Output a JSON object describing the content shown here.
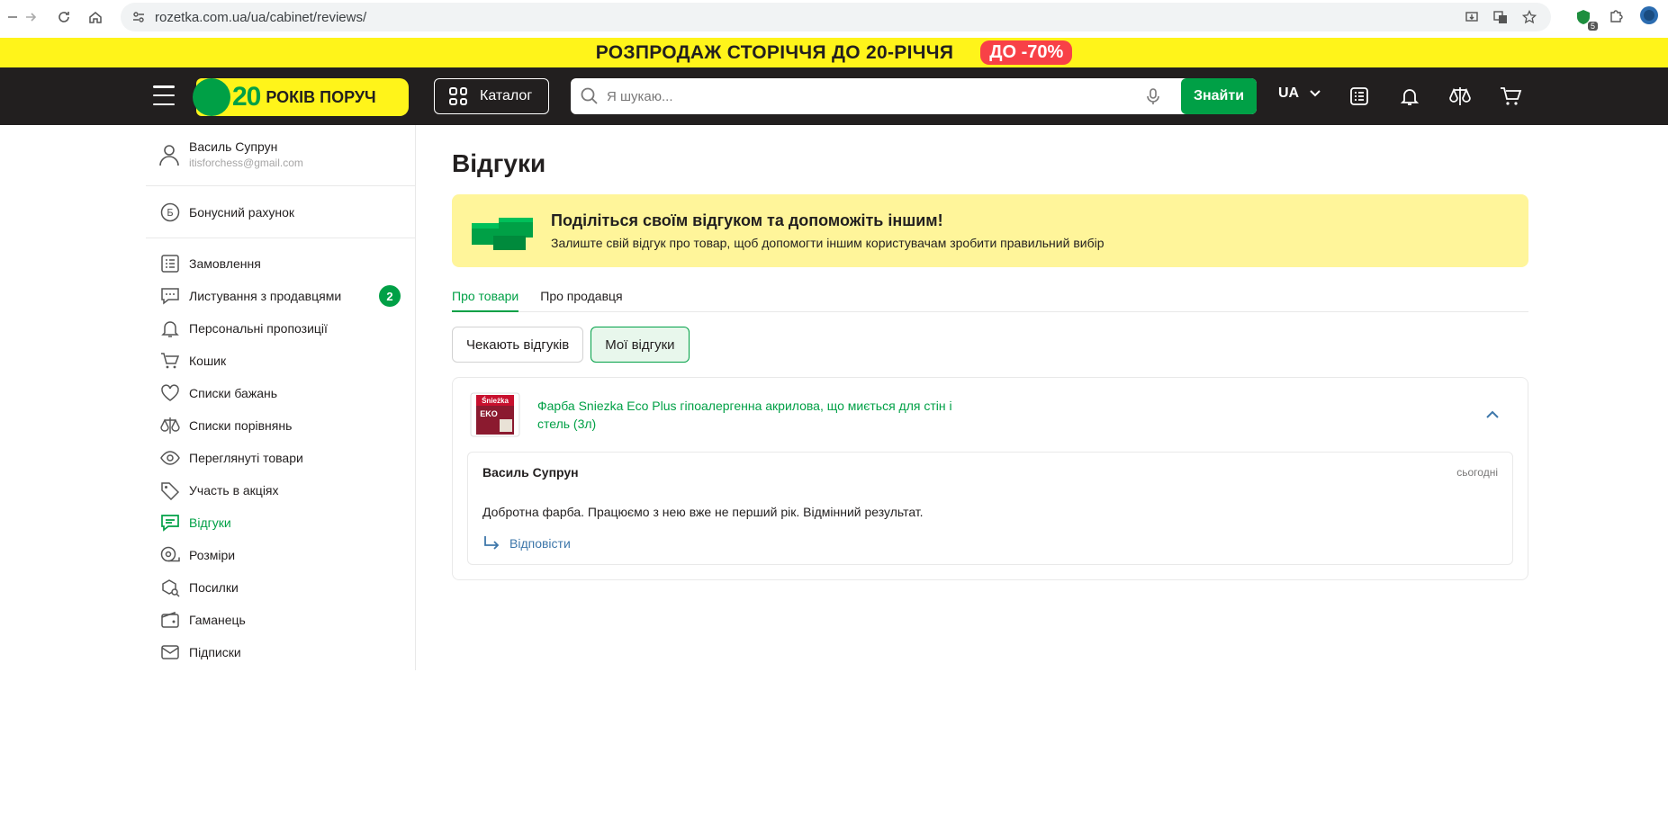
{
  "browser": {
    "url": "rozetka.com.ua/ua/cabinet/reviews/",
    "extension_badge": "5"
  },
  "promo": {
    "text": "РОЗПРОДАЖ СТОРІЧЧЯ ДО 20-РІЧЧЯ",
    "badge": "ДО -70%"
  },
  "header": {
    "logo_number": "20",
    "logo_text": "РОКІВ ПОРУЧ",
    "catalog_label": "Каталог",
    "search_placeholder": "Я шукаю...",
    "search_button": "Знайти",
    "language": "UA"
  },
  "sidebar": {
    "user_name": "Василь Супрун",
    "user_email": "itisforchess@gmail.com",
    "bonus_label": "Бонусний рахунок",
    "items": [
      {
        "label": "Замовлення"
      },
      {
        "label": "Листування з продавцями",
        "badge": "2"
      },
      {
        "label": "Персональні пропозиції"
      },
      {
        "label": "Кошик"
      },
      {
        "label": "Списки бажань"
      },
      {
        "label": "Списки порівнянь"
      },
      {
        "label": "Переглянуті товари"
      },
      {
        "label": "Участь в акціях"
      },
      {
        "label": "Відгуки",
        "active": true
      },
      {
        "label": "Розміри"
      },
      {
        "label": "Посилки"
      },
      {
        "label": "Гаманець"
      },
      {
        "label": "Підписки"
      }
    ]
  },
  "main": {
    "title": "Відгуки",
    "banner": {
      "title": "Поділіться своїм відгуком та допоможіть іншим!",
      "subtitle": "Залиште свій відгук про товар, щоб допомогти іншим користувачам зробити правильний вибір"
    },
    "tabs": [
      {
        "label": "Про товари",
        "active": true
      },
      {
        "label": "Про продавця",
        "active": false
      }
    ],
    "filters": [
      {
        "label": "Чекають відгуків",
        "active": false
      },
      {
        "label": "Мої відгуки",
        "active": true
      }
    ],
    "review": {
      "product_name": "Фарба Sniezka Eco Plus гіпоалергенна акрилова, що миється для стін і стель (3л)",
      "author": "Василь Супрун",
      "date": "сьогодні",
      "text": "Добротна фарба. Працюємо з нею вже не перший рік. Відмінний результат.",
      "reply_label": "Відповісти"
    }
  },
  "colors": {
    "brand_green": "#00a046",
    "promo_yellow": "#fff41a",
    "header_dark": "#221f1f",
    "badge_red": "#f84147",
    "banner_yellow": "#fff59a",
    "link_blue": "#3e77aa"
  }
}
